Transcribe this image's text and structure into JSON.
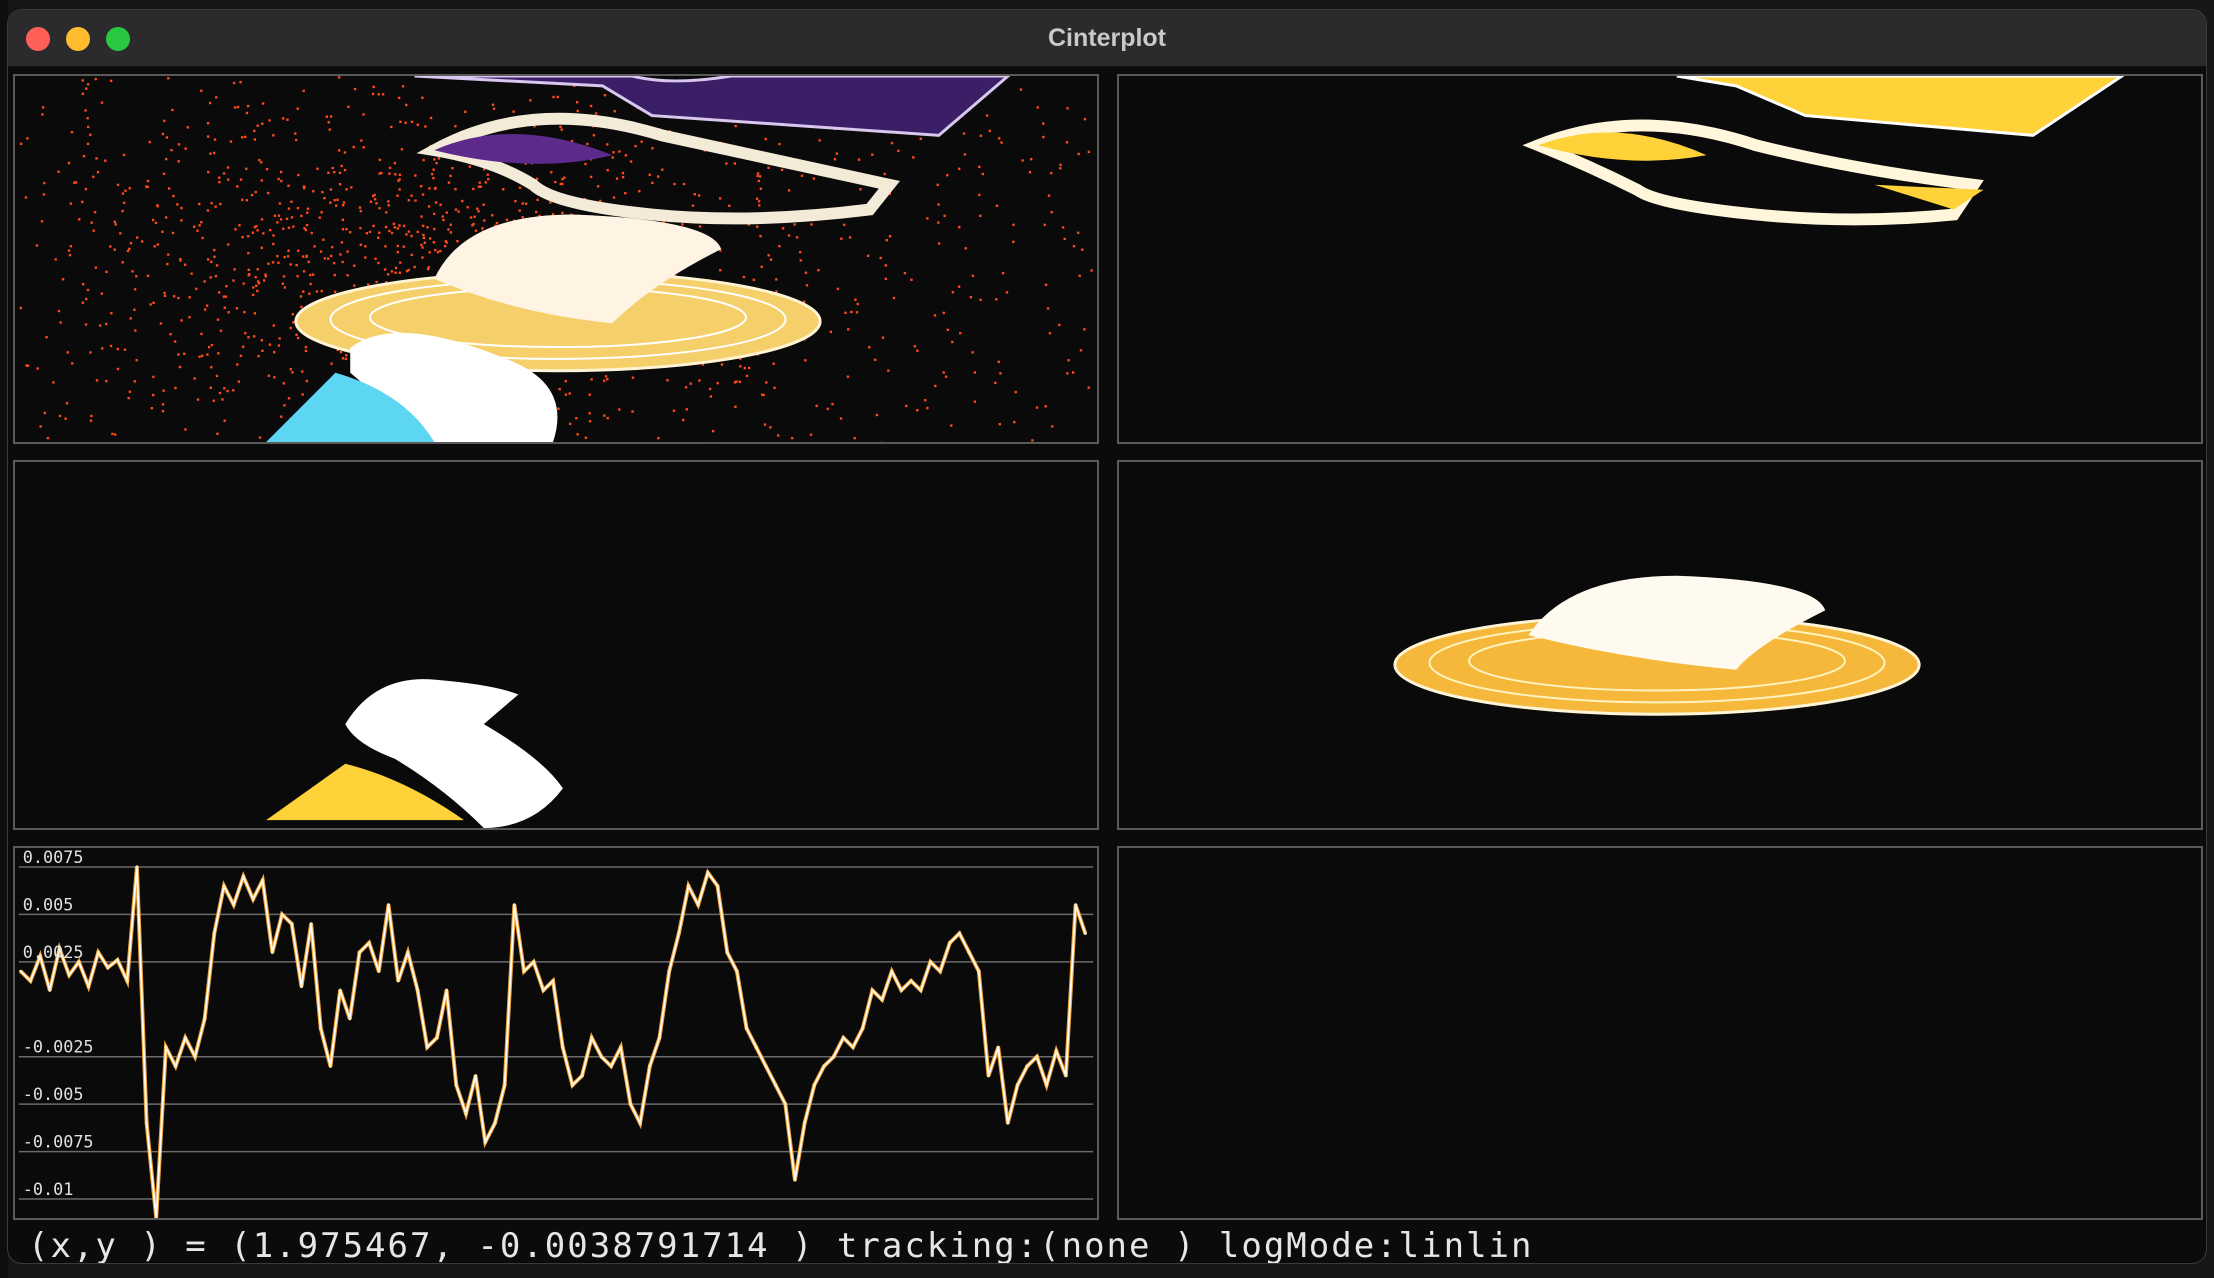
{
  "window": {
    "title": "Cinterplot"
  },
  "status": {
    "text": "(x,y ) = (1.975467, -0.0038791714 ) tracking:(none ) logMode:linlin"
  },
  "colors": {
    "titlebar": "#2b2b2d",
    "close": "#fe5f57",
    "minimize": "#febc2e",
    "zoom": "#28c840",
    "panel_border": "#5a5a5a",
    "scatter": "#ff4a1c",
    "surface_white": "#ffffff",
    "surface_yellow": "#ffd23a",
    "surface_purple": "#5b2a8a",
    "surface_cyan": "#5cd6f2"
  },
  "panels": [
    {
      "name": "panel-surfaces-scatter"
    },
    {
      "name": "panel-ribbons-yellow"
    },
    {
      "name": "panel-ribbon-small"
    },
    {
      "name": "panel-disc"
    },
    {
      "name": "panel-timeseries"
    },
    {
      "name": "panel-empty"
    }
  ],
  "chart_data": {
    "type": "line",
    "yticks": [
      "0.0075",
      "0.005",
      "0.0025",
      "-0.0025",
      "-0.005",
      "-0.0075",
      "-0.01"
    ],
    "ylim": [
      -0.011,
      0.0085
    ],
    "grid": true,
    "series": [
      {
        "values": [
          0.002,
          0.0015,
          0.0028,
          0.001,
          0.0032,
          0.0018,
          0.0025,
          0.0012,
          0.003,
          0.0022,
          0.0026,
          0.0015,
          0.0075,
          -0.006,
          -0.011,
          -0.002,
          -0.003,
          -0.0015,
          -0.0025,
          -0.0005,
          0.004,
          0.0065,
          0.0055,
          0.007,
          0.0058,
          0.0068,
          0.003,
          0.005,
          0.0045,
          0.0012,
          0.0045,
          -0.001,
          -0.003,
          0.001,
          -0.0005,
          0.003,
          0.0035,
          0.002,
          0.0055,
          0.0015,
          0.003,
          0.001,
          -0.002,
          -0.0015,
          0.001,
          -0.004,
          -0.0055,
          -0.0035,
          -0.007,
          -0.006,
          -0.004,
          0.0055,
          0.002,
          0.0025,
          0.001,
          0.0015,
          -0.002,
          -0.004,
          -0.0035,
          -0.0015,
          -0.0025,
          -0.003,
          -0.002,
          -0.005,
          -0.006,
          -0.003,
          -0.0015,
          0.002,
          0.004,
          0.0065,
          0.0055,
          0.0072,
          0.0065,
          0.003,
          0.002,
          -0.001,
          -0.002,
          -0.003,
          -0.004,
          -0.005,
          -0.009,
          -0.006,
          -0.004,
          -0.003,
          -0.0025,
          -0.0015,
          -0.002,
          -0.001,
          0.001,
          0.0005,
          0.002,
          0.001,
          0.0015,
          0.001,
          0.0025,
          0.002,
          0.0035,
          0.004,
          0.003,
          0.002,
          -0.0035,
          -0.002,
          -0.006,
          -0.004,
          -0.003,
          -0.0025,
          -0.004,
          -0.0022,
          -0.0035,
          0.0055,
          0.004
        ]
      }
    ]
  }
}
